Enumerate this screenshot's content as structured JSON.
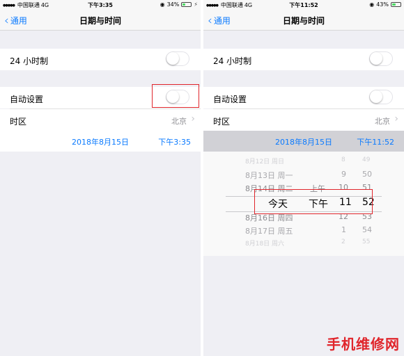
{
  "left": {
    "status": {
      "carrier": "中国联通",
      "network": "4G",
      "time": "下午3:35",
      "battery_pct": "34%",
      "battery_level": 0.34
    },
    "nav": {
      "back_label": "通用",
      "title": "日期与时间"
    },
    "cells": {
      "hour24_label": "24 小时制",
      "auto_label": "自动设置",
      "timezone_label": "时区",
      "timezone_value": "北京"
    },
    "datetime": {
      "date": "2018年8月15日",
      "time": "下午3:35"
    }
  },
  "right": {
    "status": {
      "carrier": "中国联通",
      "network": "4G",
      "time": "下午11:52",
      "battery_pct": "43%",
      "battery_level": 0.43
    },
    "nav": {
      "back_label": "通用",
      "title": "日期与时间"
    },
    "cells": {
      "hour24_label": "24 小时制",
      "auto_label": "自动设置",
      "timezone_label": "时区",
      "timezone_value": "北京"
    },
    "datetime": {
      "date": "2018年8月15日",
      "time": "下午11:52"
    },
    "picker": {
      "rows": [
        {
          "day": "8月12日 周日",
          "ampm": "",
          "hour": "8",
          "minute": "49"
        },
        {
          "day": "8月13日 周一",
          "ampm": "",
          "hour": "9",
          "minute": "50"
        },
        {
          "day": "8月14日 周二",
          "ampm": "上午",
          "hour": "10",
          "minute": "51"
        },
        {
          "day": "今天",
          "ampm": "下午",
          "hour": "11",
          "minute": "52"
        },
        {
          "day": "8月16日 周四",
          "ampm": "",
          "hour": "12",
          "minute": "53"
        },
        {
          "day": "8月17日 周五",
          "ampm": "",
          "hour": "1",
          "minute": "54"
        },
        {
          "day": "8月18日 周六",
          "ampm": "",
          "hour": "2",
          "minute": "55"
        }
      ]
    }
  },
  "watermark": "手机维修网",
  "colors": {
    "accent": "#0a7aff",
    "highlight": "#e0252b",
    "battery": "#4cd964"
  }
}
